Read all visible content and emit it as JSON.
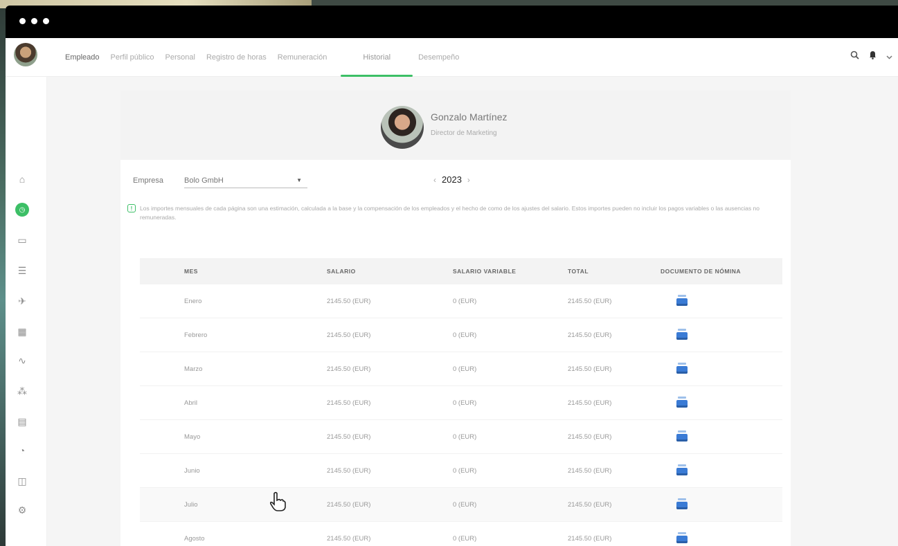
{
  "nav": {
    "tabs": [
      "Empleado",
      "Perfil público",
      "Personal",
      "Registro de horas",
      "Remuneración",
      "Historial",
      "Desempeño"
    ],
    "active_tab": "Historial"
  },
  "profile": {
    "name": "Gonzalo Martínez",
    "role": "Director de Marketing"
  },
  "filters": {
    "company_label": "Empresa",
    "company_value": "Bolo GmbH",
    "year": "2023",
    "prev": "‹",
    "next": "›"
  },
  "info_text": "Los importes mensuales de cada página son una estimación, calculada a la base y la compensación de los empleados y el hecho de como de los ajustes del salario. Estos importes pueden no incluir los pagos variables o las ausencias no remuneradas.",
  "table": {
    "headers": [
      "MES",
      "SALARIO",
      "SALARIO VARIABLE",
      "TOTAL",
      "DOCUMENTO DE NÓMINA"
    ],
    "rows": [
      {
        "mes": "Enero",
        "salario": "2145.50 (EUR)",
        "variable": "0 (EUR)",
        "total": "2145.50 (EUR)"
      },
      {
        "mes": "Febrero",
        "salario": "2145.50 (EUR)",
        "variable": "0 (EUR)",
        "total": "2145.50 (EUR)"
      },
      {
        "mes": "Marzo",
        "salario": "2145.50 (EUR)",
        "variable": "0 (EUR)",
        "total": "2145.50 (EUR)"
      },
      {
        "mes": "Abril",
        "salario": "2145.50 (EUR)",
        "variable": "0 (EUR)",
        "total": "2145.50 (EUR)"
      },
      {
        "mes": "Mayo",
        "salario": "2145.50 (EUR)",
        "variable": "0 (EUR)",
        "total": "2145.50 (EUR)"
      },
      {
        "mes": "Junio",
        "salario": "2145.50 (EUR)",
        "variable": "0 (EUR)",
        "total": "2145.50 (EUR)"
      },
      {
        "mes": "Julio",
        "salario": "2145.50 (EUR)",
        "variable": "0 (EUR)",
        "total": "2145.50 (EUR)"
      },
      {
        "mes": "Agosto",
        "salario": "2145.50 (EUR)",
        "variable": "0 (EUR)",
        "total": "2145.50 (EUR)"
      }
    ]
  },
  "icons": {
    "sidebar": [
      "home-icon",
      "clock-active-icon",
      "briefcase-icon",
      "filter-icon",
      "plane-icon",
      "calendar-icon",
      "activity-icon",
      "org-chart-icon",
      "clipboard-icon",
      "clock-icon",
      "bag-icon",
      "settings-icon"
    ],
    "top": [
      "search-icon",
      "notification-icon",
      "chevron-down-icon"
    ],
    "row": "payslip-document-icon"
  },
  "colors": {
    "accent": "#3cbf66",
    "doc_icon": "#3a7bd5",
    "titlebar": "#000000"
  }
}
